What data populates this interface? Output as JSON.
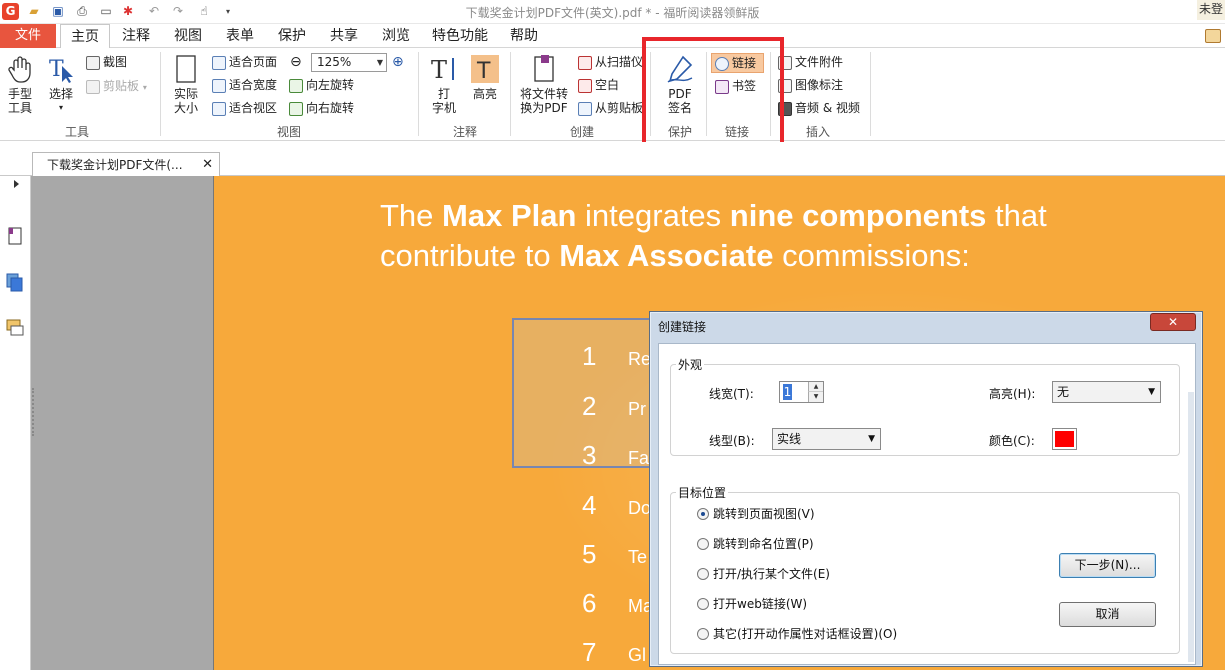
{
  "window": {
    "title": "下载奖金计划PDF文件(英文).pdf * - 福昕阅读器领鲜版",
    "user_label": "未登"
  },
  "tabs": [
    "文件",
    "主页",
    "注释",
    "视图",
    "表单",
    "保护",
    "共享",
    "浏览",
    "特色功能",
    "帮助"
  ],
  "ribbon": {
    "tools": {
      "hand": "手型\n工具",
      "select": "选择",
      "screenshot": "截图",
      "clipboard": "剪贴板",
      "group": "工具"
    },
    "view": {
      "actual_size": "实际\n大小",
      "fit_page": "适合页面",
      "fit_width": "适合宽度",
      "fit_view": "适合视区",
      "zoom": "125%",
      "rotate_left": "向左旋转",
      "rotate_right": "向右旋转",
      "group": "视图"
    },
    "comment": {
      "typewriter": "打\n字机",
      "highlight": "高亮",
      "group": "注释"
    },
    "create": {
      "convert": "将文件转\n换为PDF",
      "from_scanner": "从扫描仪",
      "blank": "空白",
      "from_clipboard": "从剪贴板",
      "group": "创建"
    },
    "protect": {
      "pdf_sign": "PDF\n签名",
      "group": "保护"
    },
    "links": {
      "link": "链接",
      "bookmark": "书签",
      "group": "链接"
    },
    "insert": {
      "attachment": "文件附件",
      "image_annot": "图像标注",
      "audio_video": "音频 & 视频",
      "group": "插入"
    }
  },
  "doc_tab": {
    "label": "下载奖金计划PDF文件(...",
    "close": "✕"
  },
  "document": {
    "line1_a": "The ",
    "line1_b": "Max Plan",
    "line1_c": " integrates ",
    "line1_d": "nine components",
    "line1_e": " that",
    "line2_a": "contribute to ",
    "line2_b": "Max Associate",
    "line2_c": " commissions:",
    "items": [
      {
        "num": "1",
        "text": "Re"
      },
      {
        "num": "2",
        "text": "Pr"
      },
      {
        "num": "3",
        "text": "Fa"
      },
      {
        "num": "4",
        "text": "Do"
      },
      {
        "num": "5",
        "text": "Te"
      },
      {
        "num": "6",
        "text": "Ma"
      },
      {
        "num": "7",
        "text": "Gl"
      }
    ]
  },
  "dialog": {
    "title": "创建链接",
    "close": "✕",
    "appearance": {
      "legend": "外观",
      "line_width_label": "线宽(T):",
      "line_width_value": "1",
      "highlight_label": "高亮(H):",
      "highlight_value": "无",
      "line_style_label": "线型(B):",
      "line_style_value": "实线",
      "color_label": "颜色(C):",
      "color_value": "#ff0000"
    },
    "target": {
      "legend": "目标位置",
      "options": [
        {
          "label": "跳转到页面视图(V)",
          "selected": true
        },
        {
          "label": "跳转到命名位置(P)",
          "selected": false
        },
        {
          "label": "打开/执行某个文件(E)",
          "selected": false
        },
        {
          "label": "打开web链接(W)",
          "selected": false
        },
        {
          "label": "其它(打开动作属性对话框设置)(O)",
          "selected": false
        }
      ]
    },
    "next_button": "下一步(N)...",
    "cancel_button": "取消"
  },
  "colors": {
    "accent": "#e8553e",
    "doc_bg": "#f7a93b",
    "callout": "#e8262b"
  }
}
